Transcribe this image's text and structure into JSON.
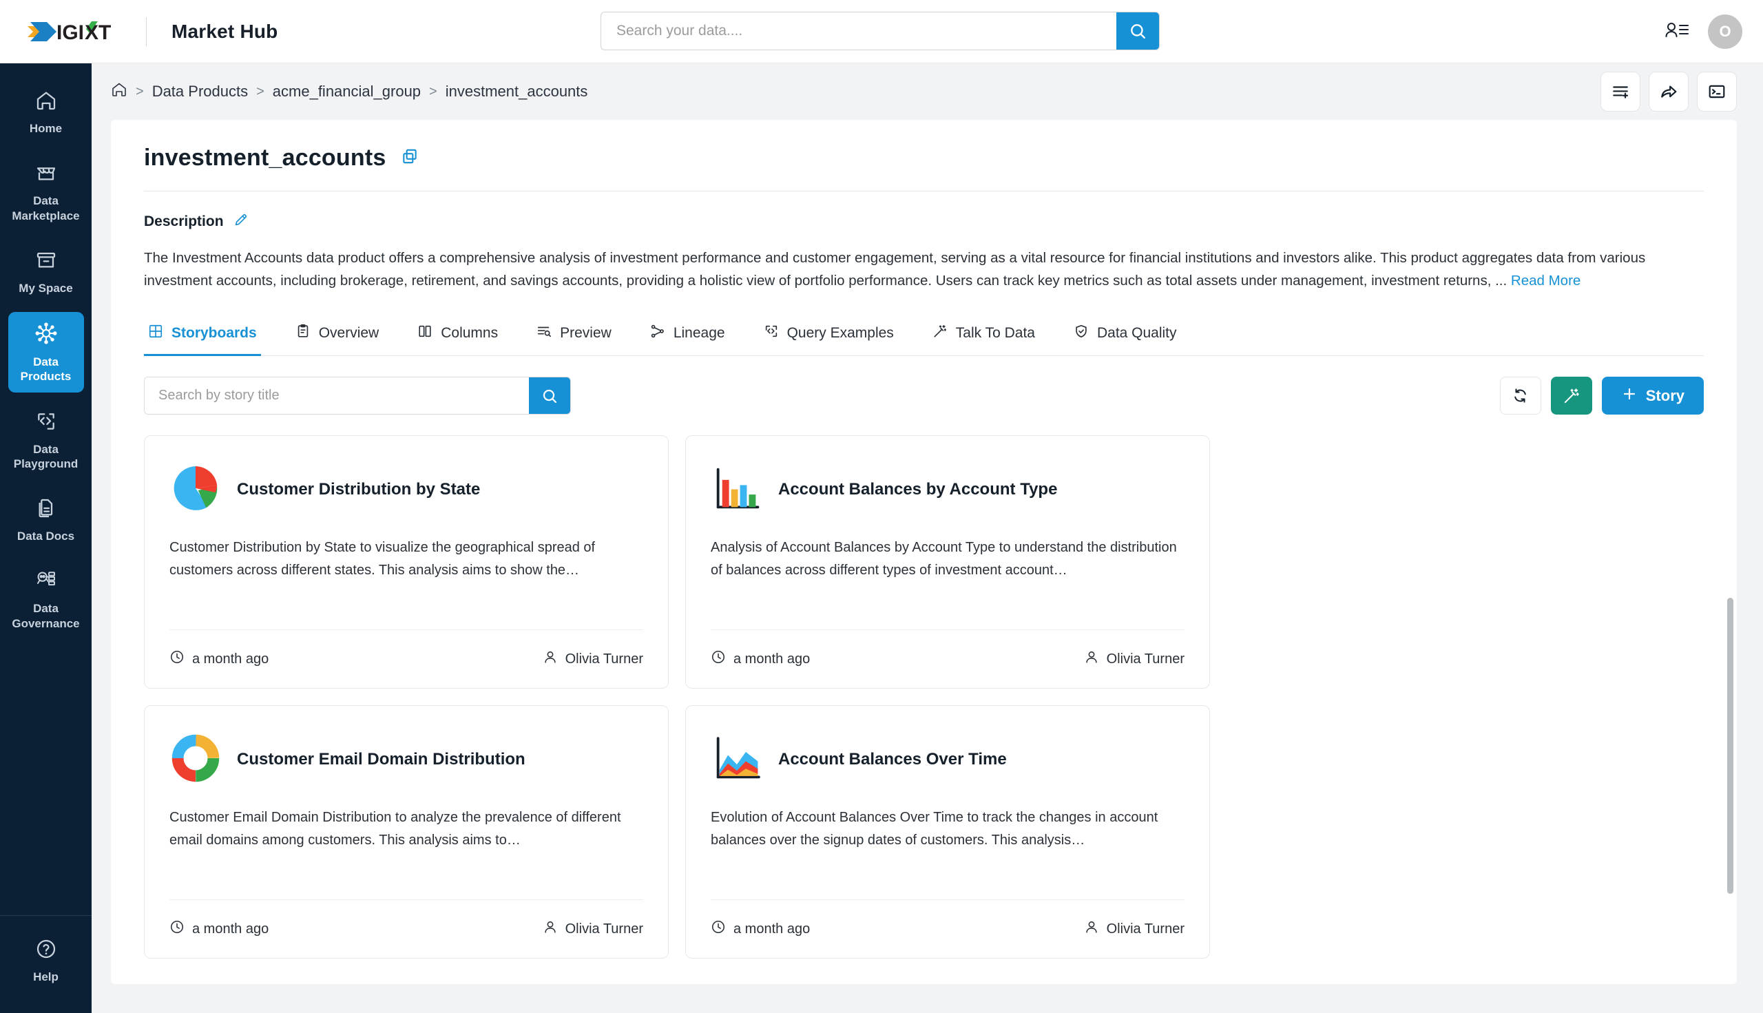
{
  "header": {
    "brand": "DIGIXT",
    "app_title": "Market Hub",
    "search": {
      "value": "",
      "placeholder": "Search your data...."
    },
    "search_icon": "search-icon",
    "contacts_icon": "user-list-icon",
    "avatar_initial": "O"
  },
  "sidebar": {
    "items": [
      {
        "label": "Home",
        "icon": "home-icon",
        "active": false
      },
      {
        "label": "Data Marketplace",
        "icon": "store-icon",
        "active": false
      },
      {
        "label": "My Space",
        "icon": "archive-icon",
        "active": false
      },
      {
        "label": "Data Products",
        "icon": "network-node-icon",
        "active": true
      },
      {
        "label": "Data Playground",
        "icon": "code-brackets-icon",
        "active": false
      },
      {
        "label": "Data Docs",
        "icon": "documents-icon",
        "active": false
      },
      {
        "label": "Data Governance",
        "icon": "magnifier-database-icon",
        "active": false
      }
    ],
    "help": {
      "label": "Help",
      "icon": "question-circle-icon"
    },
    "active_color": "#1791d6",
    "background": "#0b1f35"
  },
  "breadcrumb": {
    "home_icon": "home-icon",
    "separator": ">",
    "items": [
      "Data Products",
      "acme_financial_group",
      "investment_accounts"
    ],
    "actions": [
      {
        "icon": "list-add-icon",
        "name": "add-to-list-button"
      },
      {
        "icon": "share-arrow-icon",
        "name": "share-button"
      },
      {
        "icon": "terminal-icon",
        "name": "terminal-button"
      }
    ]
  },
  "product": {
    "title": "investment_accounts",
    "copy_icon": "copy-icon",
    "description_label": "Description",
    "edit_icon": "pencil-edit-icon",
    "description": "The Investment Accounts data product offers a comprehensive analysis of investment performance and customer engagement, serving as a vital resource for financial institutions and investors alike. This product aggregates data from various investment accounts, including brokerage, retirement, and savings accounts, providing a holistic view of portfolio performance. Users can track key metrics such as total assets under management, investment returns, ...",
    "read_more": "Read More"
  },
  "tabs": [
    {
      "label": "Storyboards",
      "icon": "grid-icon",
      "active": true
    },
    {
      "label": "Overview",
      "icon": "clipboard-icon",
      "active": false
    },
    {
      "label": "Columns",
      "icon": "columns-icon",
      "active": false
    },
    {
      "label": "Preview",
      "icon": "list-search-icon",
      "active": false
    },
    {
      "label": "Lineage",
      "icon": "lineage-icon",
      "active": false
    },
    {
      "label": "Query Examples",
      "icon": "code-icon",
      "active": false
    },
    {
      "label": "Talk To Data",
      "icon": "magic-wand-icon",
      "active": false
    },
    {
      "label": "Data Quality",
      "icon": "shield-check-icon",
      "active": false
    }
  ],
  "storyboards": {
    "search": {
      "value": "",
      "placeholder": "Search by story title"
    },
    "search_icon": "search-icon",
    "refresh_icon": "refresh-icon",
    "magic_icon": "magic-wand-icon",
    "add_story_label": "Story",
    "add_icon": "plus-icon",
    "accent_color": "#1791d6",
    "teal_color": "#17967f",
    "cards": [
      {
        "thumb": "pie-chart-icon",
        "title": "Customer Distribution by State",
        "description": "Customer Distribution by State to visualize the geographical spread of customers across different states. This analysis aims to show the…",
        "time": "a month ago",
        "time_icon": "clock-icon",
        "author": "Olivia Turner",
        "author_icon": "user-icon"
      },
      {
        "thumb": "bar-chart-icon",
        "title": "Account Balances by Account Type",
        "description": "Analysis of Account Balances by Account Type to understand the distribution of balances across different types of investment account…",
        "time": "a month ago",
        "time_icon": "clock-icon",
        "author": "Olivia Turner",
        "author_icon": "user-icon"
      },
      {
        "thumb": "donut-chart-icon",
        "title": "Customer Email Domain Distribution",
        "description": "Customer Email Domain Distribution to analyze the prevalence of different email domains among customers. This analysis aims to…",
        "time": "a month ago",
        "time_icon": "clock-icon",
        "author": "Olivia Turner",
        "author_icon": "user-icon"
      },
      {
        "thumb": "area-chart-icon",
        "title": "Account Balances Over Time",
        "description": "Evolution of Account Balances Over Time to track the changes in account balances over the signup dates of customers. This analysis…",
        "time": "a month ago",
        "time_icon": "clock-icon",
        "author": "Olivia Turner",
        "author_icon": "user-icon"
      }
    ]
  }
}
